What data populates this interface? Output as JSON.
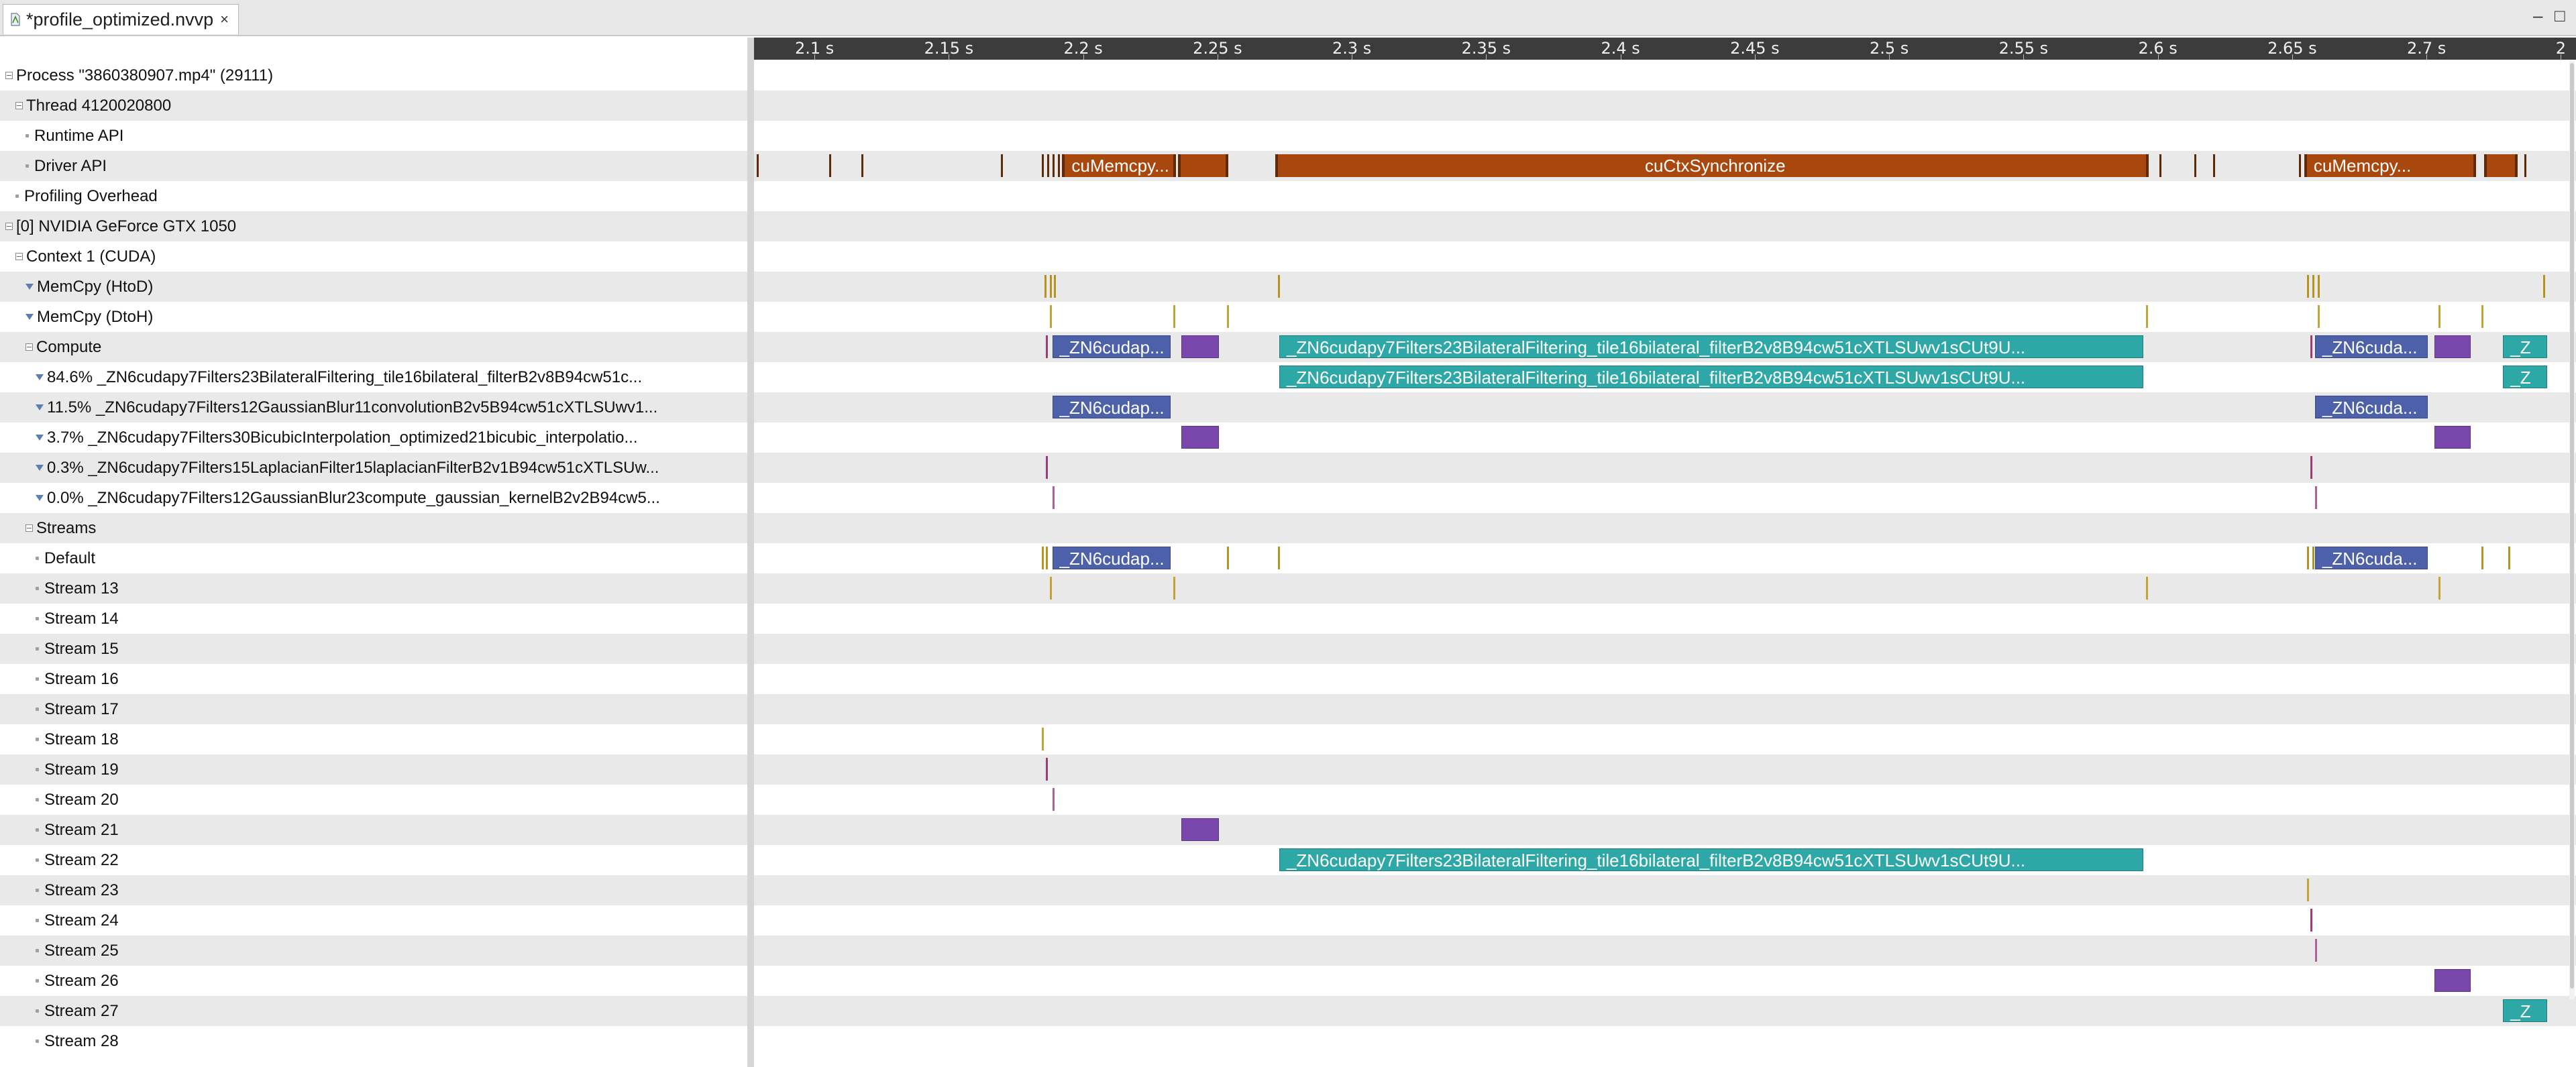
{
  "editor": {
    "tab_title": "*profile_optimized.nvvp",
    "close_glyph": "×",
    "minimize_glyph": "–",
    "maximize_glyph": "□",
    "file_icon": "nvvp-file-icon"
  },
  "timeline": {
    "ticks": [
      "2.1 s",
      "2.15 s",
      "2.2 s",
      "2.25 s",
      "2.3 s",
      "2.35 s",
      "2.4 s",
      "2.45 s",
      "2.5 s",
      "2.55 s",
      "2.6 s",
      "2.65 s",
      "2.7 s",
      "2"
    ],
    "colors": {
      "driver": "#a8480e",
      "driver_dark": "#5e2a08",
      "memcpy_htod": "#b8921e",
      "memcpy_dtoh": "#c4a234",
      "kernel_bilateral": "#2ea8a6",
      "kernel_gaussian": "#4d61aa",
      "kernel_bicubic": "#7a47ad",
      "kernel_laplacian": "#a23c74",
      "kernel_compute_gaussian": "#b06095"
    }
  },
  "rows": [
    {
      "label": "Process \"3860380907.mp4\" (29111)",
      "indent": 0,
      "icon": "expander"
    },
    {
      "label": "Thread 4120020800",
      "indent": 1,
      "icon": "expander"
    },
    {
      "label": "Runtime API",
      "indent": 2,
      "icon": "dot"
    },
    {
      "label": "Driver API",
      "indent": 2,
      "icon": "dot"
    },
    {
      "label": "Profiling Overhead",
      "indent": 1,
      "icon": "dot"
    },
    {
      "label": "[0] NVIDIA GeForce GTX 1050",
      "indent": 0,
      "icon": "expander"
    },
    {
      "label": "Context 1 (CUDA)",
      "indent": 1,
      "icon": "expander"
    },
    {
      "label": "MemCpy (HtoD)",
      "indent": 2,
      "icon": "funnel"
    },
    {
      "label": "MemCpy (DtoH)",
      "indent": 2,
      "icon": "funnel"
    },
    {
      "label": "Compute",
      "indent": 2,
      "icon": "expander"
    },
    {
      "label": "84.6% _ZN6cudapy7Filters23BilateralFiltering_tile16bilateral_filterB2v8B94cw51c...",
      "indent": 3,
      "icon": "funnel"
    },
    {
      "label": "11.5% _ZN6cudapy7Filters12GaussianBlur11convolutionB2v5B94cw51cXTLSUwv1...",
      "indent": 3,
      "icon": "funnel"
    },
    {
      "label": "3.7% _ZN6cudapy7Filters30BicubicInterpolation_optimized21bicubic_interpolatio...",
      "indent": 3,
      "icon": "funnel"
    },
    {
      "label": "0.3% _ZN6cudapy7Filters15LaplacianFilter15laplacianFilterB2v1B94cw51cXTLSUw...",
      "indent": 3,
      "icon": "funnel"
    },
    {
      "label": "0.0% _ZN6cudapy7Filters12GaussianBlur23compute_gaussian_kernelB2v2B94cw5...",
      "indent": 3,
      "icon": "funnel"
    },
    {
      "label": "Streams",
      "indent": 2,
      "icon": "expander"
    },
    {
      "label": "Default",
      "indent": 3,
      "icon": "dot"
    },
    {
      "label": "Stream 13",
      "indent": 3,
      "icon": "dot"
    },
    {
      "label": "Stream 14",
      "indent": 3,
      "icon": "dot"
    },
    {
      "label": "Stream 15",
      "indent": 3,
      "icon": "dot"
    },
    {
      "label": "Stream 16",
      "indent": 3,
      "icon": "dot"
    },
    {
      "label": "Stream 17",
      "indent": 3,
      "icon": "dot"
    },
    {
      "label": "Stream 18",
      "indent": 3,
      "icon": "dot"
    },
    {
      "label": "Stream 19",
      "indent": 3,
      "icon": "dot"
    },
    {
      "label": "Stream 20",
      "indent": 3,
      "icon": "dot"
    },
    {
      "label": "Stream 21",
      "indent": 3,
      "icon": "dot"
    },
    {
      "label": "Stream 22",
      "indent": 3,
      "icon": "dot"
    },
    {
      "label": "Stream 23",
      "indent": 3,
      "icon": "dot"
    },
    {
      "label": "Stream 24",
      "indent": 3,
      "icon": "dot"
    },
    {
      "label": "Stream 25",
      "indent": 3,
      "icon": "dot"
    },
    {
      "label": "Stream 26",
      "indent": 3,
      "icon": "dot"
    },
    {
      "label": "Stream 27",
      "indent": 3,
      "icon": "dot"
    },
    {
      "label": "Stream 28",
      "indent": 3,
      "icon": "dot"
    }
  ],
  "bars": [
    {
      "row": 3,
      "kind": "driver",
      "label": "cuMemcpy...",
      "start": 2.1922,
      "end": 2.2345
    },
    {
      "row": 3,
      "kind": "driver",
      "label": "",
      "start": 2.2352,
      "end": 2.254
    },
    {
      "row": 3,
      "kind": "driver",
      "label": "cuCtxSynchronize",
      "start": 2.2715,
      "end": 2.5965
    },
    {
      "row": 3,
      "kind": "driver",
      "label": "cuMemcpy...",
      "start": 2.6545,
      "end": 2.7185
    },
    {
      "row": 3,
      "kind": "driver",
      "label": "",
      "start": 2.7215,
      "end": 2.734
    },
    {
      "row": 9,
      "kind": "kernel_gaussian",
      "label": "_ZN6cudap...",
      "start": 2.1885,
      "end": 2.2325
    },
    {
      "row": 9,
      "kind": "kernel_bicubic",
      "label": "",
      "start": 2.2365,
      "end": 2.2505
    },
    {
      "row": 9,
      "kind": "kernel_bilateral",
      "label": "_ZN6cudapy7Filters23BilateralFiltering_tile16bilateral_filterB2v8B94cw51cXTLSUwv1sCUt9U...",
      "start": 2.273,
      "end": 2.5945
    },
    {
      "row": 9,
      "kind": "kernel_gaussian",
      "label": "_ZN6cuda...",
      "start": 2.6585,
      "end": 2.7005
    },
    {
      "row": 9,
      "kind": "kernel_bicubic",
      "label": "",
      "start": 2.703,
      "end": 2.7165
    },
    {
      "row": 9,
      "kind": "kernel_bilateral",
      "label": "_Z",
      "start": 2.7285,
      "end": 2.745
    },
    {
      "row": 10,
      "kind": "kernel_bilateral",
      "label": "_ZN6cudapy7Filters23BilateralFiltering_tile16bilateral_filterB2v8B94cw51cXTLSUwv1sCUt9U...",
      "start": 2.273,
      "end": 2.5945
    },
    {
      "row": 10,
      "kind": "kernel_bilateral",
      "label": "_Z",
      "start": 2.7285,
      "end": 2.745
    },
    {
      "row": 11,
      "kind": "kernel_gaussian",
      "label": "_ZN6cudap...",
      "start": 2.1885,
      "end": 2.2325
    },
    {
      "row": 11,
      "kind": "kernel_gaussian",
      "label": "_ZN6cuda...",
      "start": 2.6585,
      "end": 2.7005
    },
    {
      "row": 12,
      "kind": "kernel_bicubic",
      "label": "",
      "start": 2.2365,
      "end": 2.2505
    },
    {
      "row": 12,
      "kind": "kernel_bicubic",
      "label": "",
      "start": 2.703,
      "end": 2.7165
    },
    {
      "row": 16,
      "kind": "kernel_gaussian",
      "label": "_ZN6cudap...",
      "start": 2.1885,
      "end": 2.2325
    },
    {
      "row": 16,
      "kind": "kernel_gaussian",
      "label": "_ZN6cuda...",
      "start": 2.6585,
      "end": 2.7005
    },
    {
      "row": 25,
      "kind": "kernel_bicubic",
      "label": "",
      "start": 2.2365,
      "end": 2.2505
    },
    {
      "row": 26,
      "kind": "kernel_bilateral",
      "label": "_ZN6cudapy7Filters23BilateralFiltering_tile16bilateral_filterB2v8B94cw51cXTLSUwv1sCUt9U...",
      "start": 2.273,
      "end": 2.5945
    },
    {
      "row": 30,
      "kind": "kernel_bicubic",
      "label": "",
      "start": 2.703,
      "end": 2.7165
    },
    {
      "row": 31,
      "kind": "kernel_bilateral",
      "label": "_Z",
      "start": 2.7285,
      "end": 2.745
    }
  ],
  "markers": [
    {
      "row": 3,
      "kind": "driver_dark",
      "t": 2.0785
    },
    {
      "row": 3,
      "kind": "driver_dark",
      "t": 2.1055
    },
    {
      "row": 3,
      "kind": "driver_dark",
      "t": 2.1175
    },
    {
      "row": 3,
      "kind": "driver_dark",
      "t": 2.1695
    },
    {
      "row": 3,
      "kind": "driver_dark",
      "t": 2.1845
    },
    {
      "row": 3,
      "kind": "driver_dark",
      "t": 2.1865
    },
    {
      "row": 3,
      "kind": "driver_dark",
      "t": 2.1885
    },
    {
      "row": 3,
      "kind": "driver_dark",
      "t": 2.1905
    },
    {
      "row": 3,
      "kind": "driver_dark",
      "t": 2.2355
    },
    {
      "row": 3,
      "kind": "driver_dark",
      "t": 2.2375
    },
    {
      "row": 3,
      "kind": "driver_dark",
      "t": 2.6005
    },
    {
      "row": 3,
      "kind": "driver_dark",
      "t": 2.6135
    },
    {
      "row": 3,
      "kind": "driver_dark",
      "t": 2.6205
    },
    {
      "row": 3,
      "kind": "driver_dark",
      "t": 2.6525
    },
    {
      "row": 3,
      "kind": "driver_dark",
      "t": 2.6545
    },
    {
      "row": 3,
      "kind": "driver_dark",
      "t": 2.7365
    },
    {
      "row": 7,
      "kind": "memcpy_htod",
      "t": 2.1855
    },
    {
      "row": 7,
      "kind": "memcpy_htod",
      "t": 2.1875
    },
    {
      "row": 7,
      "kind": "memcpy_htod",
      "t": 2.1892
    },
    {
      "row": 7,
      "kind": "memcpy_htod",
      "t": 2.2725
    },
    {
      "row": 7,
      "kind": "memcpy_htod",
      "t": 2.6555
    },
    {
      "row": 7,
      "kind": "memcpy_htod",
      "t": 2.6575
    },
    {
      "row": 7,
      "kind": "memcpy_htod",
      "t": 2.6595
    },
    {
      "row": 7,
      "kind": "memcpy_htod",
      "t": 2.7435
    },
    {
      "row": 8,
      "kind": "memcpy_dtoh",
      "t": 2.1875
    },
    {
      "row": 8,
      "kind": "memcpy_dtoh",
      "t": 2.2335
    },
    {
      "row": 8,
      "kind": "memcpy_dtoh",
      "t": 2.2535
    },
    {
      "row": 8,
      "kind": "memcpy_dtoh",
      "t": 2.5955
    },
    {
      "row": 8,
      "kind": "memcpy_dtoh",
      "t": 2.6595
    },
    {
      "row": 8,
      "kind": "memcpy_dtoh",
      "t": 2.7045
    },
    {
      "row": 8,
      "kind": "memcpy_dtoh",
      "t": 2.7205
    },
    {
      "row": 9,
      "kind": "kernel_laplacian",
      "t": 2.1862
    },
    {
      "row": 9,
      "kind": "kernel_laplacian",
      "t": 2.6568
    },
    {
      "row": 13,
      "kind": "kernel_laplacian",
      "t": 2.1862
    },
    {
      "row": 13,
      "kind": "kernel_laplacian",
      "t": 2.6568
    },
    {
      "row": 14,
      "kind": "kernel_compute_gaussian",
      "t": 2.1885
    },
    {
      "row": 14,
      "kind": "kernel_compute_gaussian",
      "t": 2.6585
    },
    {
      "row": 16,
      "kind": "memcpy_htod",
      "t": 2.1845
    },
    {
      "row": 16,
      "kind": "memcpy_htod",
      "t": 2.1862
    },
    {
      "row": 16,
      "kind": "memcpy_htod",
      "t": 2.2535
    },
    {
      "row": 16,
      "kind": "memcpy_htod",
      "t": 2.2725
    },
    {
      "row": 16,
      "kind": "memcpy_htod",
      "t": 2.6555
    },
    {
      "row": 16,
      "kind": "memcpy_htod",
      "t": 2.6575
    },
    {
      "row": 16,
      "kind": "memcpy_htod",
      "t": 2.7205
    },
    {
      "row": 16,
      "kind": "memcpy_htod",
      "t": 2.7305
    },
    {
      "row": 17,
      "kind": "memcpy_dtoh",
      "t": 2.1875
    },
    {
      "row": 17,
      "kind": "memcpy_dtoh",
      "t": 2.2335
    },
    {
      "row": 17,
      "kind": "memcpy_dtoh",
      "t": 2.5955
    },
    {
      "row": 17,
      "kind": "memcpy_dtoh",
      "t": 2.7045
    },
    {
      "row": 22,
      "kind": "memcpy_dtoh",
      "t": 2.1845
    },
    {
      "row": 23,
      "kind": "kernel_laplacian",
      "t": 2.1862
    },
    {
      "row": 24,
      "kind": "kernel_compute_gaussian",
      "t": 2.1885
    },
    {
      "row": 27,
      "kind": "memcpy_dtoh",
      "t": 2.6555
    },
    {
      "row": 28,
      "kind": "kernel_laplacian",
      "t": 2.6568
    },
    {
      "row": 29,
      "kind": "kernel_compute_gaussian",
      "t": 2.6585
    }
  ]
}
